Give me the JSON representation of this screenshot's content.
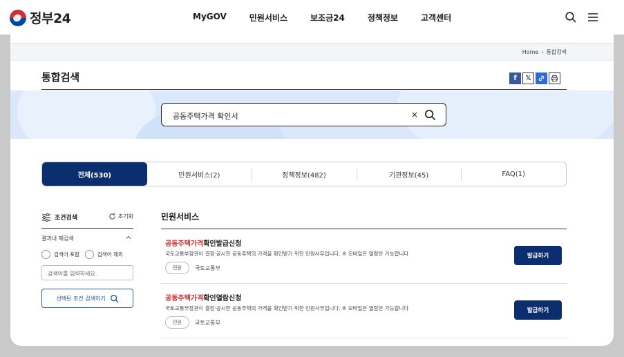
{
  "header": {
    "logo_text": "정부24",
    "nav": [
      "MyGOV",
      "민원서비스",
      "보조금24",
      "정책정보",
      "고객센터"
    ]
  },
  "breadcrumb": {
    "home": "Home",
    "separator": "›",
    "current": "통합검색"
  },
  "page_title": "통합검색",
  "search": {
    "query": "공동주택가격 확인서",
    "clear": "×"
  },
  "tabs": [
    {
      "label": "전체(530)",
      "active": true
    },
    {
      "label": "민원서비스(2)",
      "active": false
    },
    {
      "label": "정책정보(482)",
      "active": false
    },
    {
      "label": "기관정보(45)",
      "active": false
    },
    {
      "label": "FAQ(1)",
      "active": false
    }
  ],
  "sidebar": {
    "title": "조건검색",
    "reset": "초기화",
    "re_search_label": "결과내 재검색",
    "include_label": "검색어 포함",
    "exclude_label": "검색어 제외",
    "input_placeholder": "검색어를 입력하세요.",
    "submit_label": "선택된 조건 검색하기"
  },
  "section_title": "민원서비스",
  "results": [
    {
      "title_highlight": "공동주택가격",
      "title_rest": "확인발급신청",
      "desc": "국토교통부장관이 결정·공시한 공동주택의 가격을 확인받기 위한 민원사무입니다. ※ 모바일은 열람만 가능합니다",
      "tag": "민원",
      "org": "국토교통부",
      "button": "발급하기"
    },
    {
      "title_highlight": "공동주택가격",
      "title_rest": "확인열람신청",
      "desc": "국토교통부장관이 결정·공시한 공동주택의 가격을 확인받기 위한 민원사무입니다. ※ 모바일은 열람만 가능합니다",
      "tag": "민원",
      "org": "국토교통부",
      "button": "발급하기"
    }
  ],
  "colors": {
    "primary": "#0b2e6e",
    "highlight": "#d62a2a",
    "banner": "#dbe8fb"
  }
}
